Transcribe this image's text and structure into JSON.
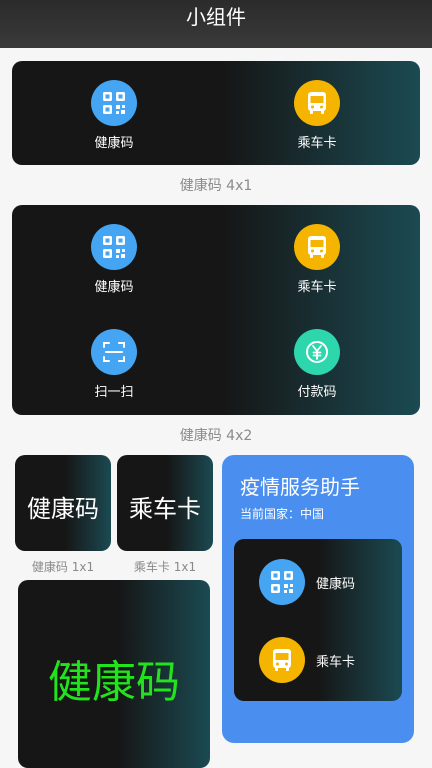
{
  "app": {
    "title": "小组件"
  },
  "widget4x1": {
    "items": [
      {
        "label": "健康码",
        "icon": "qr-code-icon",
        "color": "#45a5f2"
      },
      {
        "label": "乘车卡",
        "icon": "bus-icon",
        "color": "#f4b400"
      }
    ],
    "caption": "健康码 4x1"
  },
  "widget4x2": {
    "items": [
      {
        "label": "健康码",
        "icon": "qr-code-icon",
        "color": "#45a5f2"
      },
      {
        "label": "乘车卡",
        "icon": "bus-icon",
        "color": "#f4b400"
      },
      {
        "label": "扫一扫",
        "icon": "scan-icon",
        "color": "#45a5f2"
      },
      {
        "label": "付款码",
        "icon": "yuan-icon",
        "color": "#2ed6ad"
      }
    ],
    "caption": "健康码 4x2"
  },
  "small_widgets": [
    {
      "text": "健康码",
      "caption": "健康码 1x1"
    },
    {
      "text": "乘车卡",
      "caption": "乘车卡 1x1"
    }
  ],
  "large_widget": {
    "text": "健康码",
    "color": "#22e31c"
  },
  "service_panel": {
    "title": "疫情服务助手",
    "subtitle": "当前国家：中国",
    "items": [
      {
        "label": "健康码",
        "icon": "qr-code-icon"
      },
      {
        "label": "乘车卡",
        "icon": "bus-icon"
      }
    ],
    "bg_color": "#4a8ff0"
  }
}
